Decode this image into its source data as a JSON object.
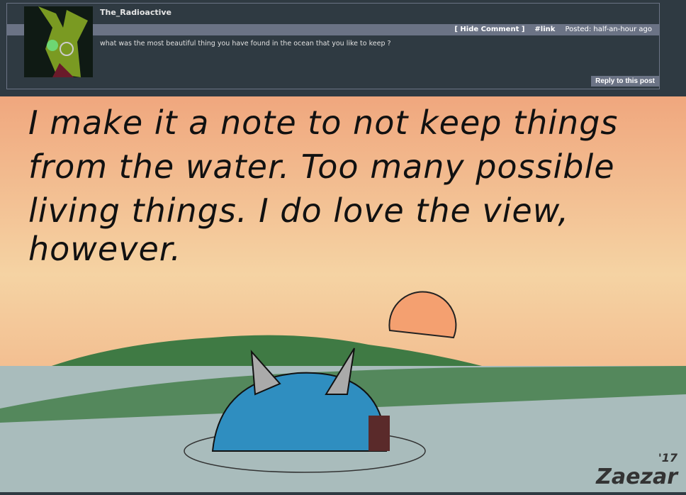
{
  "comment": {
    "username": "The_Radioactive",
    "hide_label": "[ Hide Comment ]",
    "link_label": "#link",
    "posted_label": "Posted:",
    "posted_time": "half-an-hour ago",
    "message": "what was the most beautiful thing you have found in the ocean that you like to keep ?",
    "reply_label": "Reply to this post"
  },
  "art": {
    "lines": [
      "I make it a note to not keep things",
      "from the water. Too  many possible",
      "living things. I do love the view, however."
    ],
    "signature": "Zaezar",
    "signature_year": "'17"
  }
}
